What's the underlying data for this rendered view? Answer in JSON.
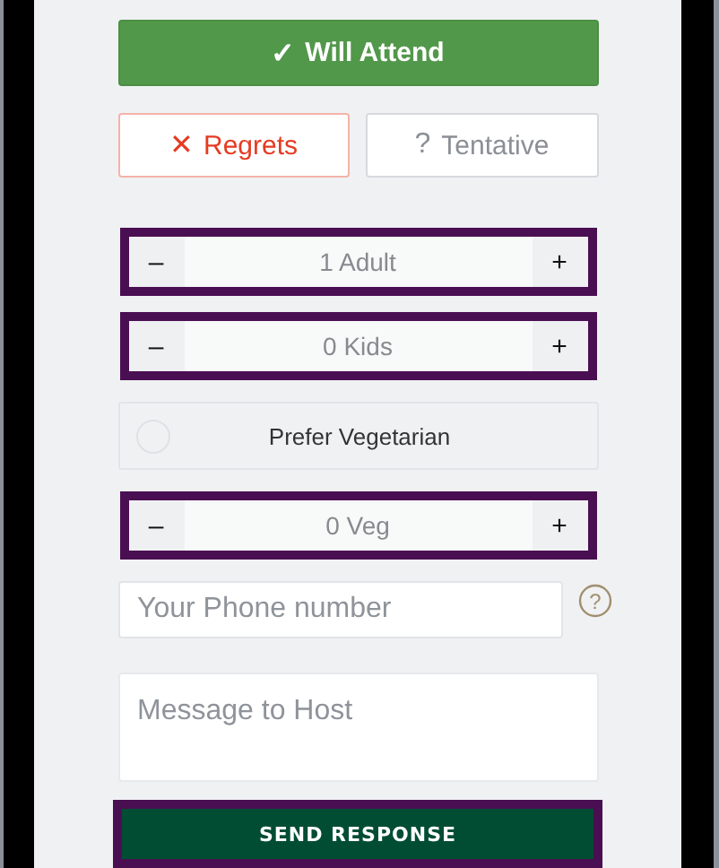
{
  "responses": [
    {
      "kind": "yes",
      "icon": "✓",
      "label": "Will Attend",
      "selected": true
    },
    {
      "kind": "no",
      "icon": "✕",
      "label": "Regrets",
      "selected": false
    },
    {
      "kind": "maybe",
      "icon": "?",
      "label": "Tentative",
      "selected": false
    }
  ],
  "counters": [
    {
      "kind": "stepper",
      "minus": "–",
      "value": "1 Adult",
      "plus": "+",
      "highlighted": true
    },
    {
      "kind": "stepper",
      "minus": "–",
      "value": "0 Kids",
      "plus": "+",
      "highlighted": true
    },
    {
      "kind": "toggle",
      "label": "Prefer Vegetarian",
      "checked": false
    },
    {
      "kind": "stepper",
      "minus": "–",
      "value": "0 Veg",
      "plus": "+",
      "highlighted": true
    }
  ],
  "phone": {
    "placeholder": "Your Phone number"
  },
  "message": {
    "placeholder": "Message to Host"
  },
  "send": {
    "label": "SEND RESPONSE",
    "highlighted": true
  }
}
